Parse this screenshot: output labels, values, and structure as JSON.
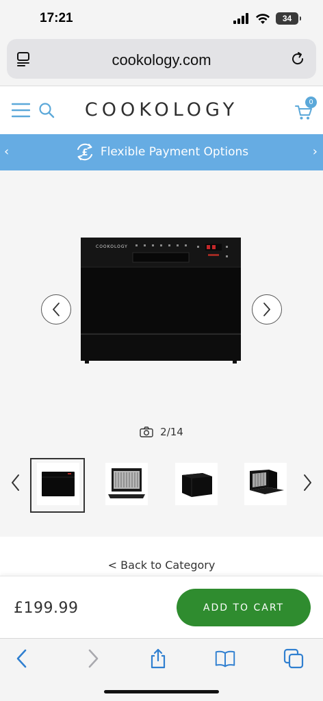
{
  "status_bar": {
    "time": "17:21",
    "battery": "34"
  },
  "browser": {
    "url": "cookology.com"
  },
  "header": {
    "logo": "COOKOLOGY",
    "cart_count": "0"
  },
  "promo": {
    "text": "Flexible Payment Options"
  },
  "gallery": {
    "product_brand": "COOKOLOGY",
    "counter": "2/14",
    "thumbnails": [
      "front-closed",
      "open-with-dishes",
      "angled-closed",
      "angled-open"
    ],
    "selected_thumbnail": 1
  },
  "back_link": "< Back to Category",
  "purchase": {
    "price": "£199.99",
    "button": "ADD TO CART"
  },
  "colors": {
    "promo": "#66ace3",
    "accent_blue": "#2f7fd0",
    "cart_button": "#2f8c2f"
  }
}
